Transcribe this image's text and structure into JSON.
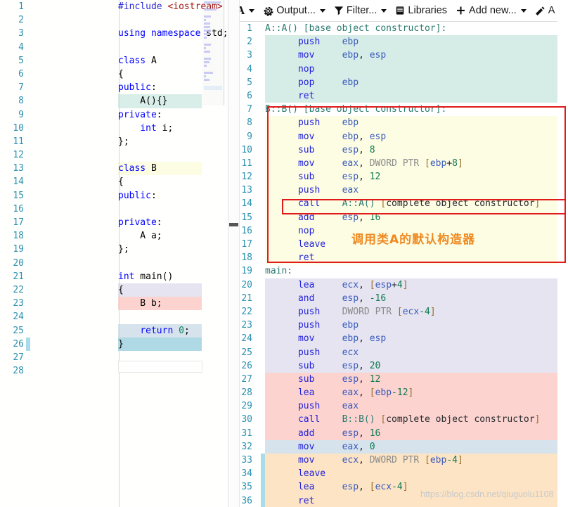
{
  "app": {
    "name": "Compiler Explorer",
    "watermark": "https://blog.csdn.net/qiuguolu1108"
  },
  "toolbar": {
    "items": [
      {
        "icon": "font-size-icon",
        "label": "A",
        "caret": true,
        "name": "font-size-button"
      },
      {
        "icon": "gear-icon",
        "label": "Output...",
        "caret": true,
        "name": "output-button"
      },
      {
        "icon": "filter-icon",
        "label": "Filter...",
        "caret": true,
        "name": "filter-button"
      },
      {
        "icon": "libraries-icon",
        "label": "Libraries",
        "caret": false,
        "name": "libraries-button"
      },
      {
        "icon": "plus-icon",
        "label": "Add new...",
        "caret": true,
        "name": "add-new-button"
      },
      {
        "icon": "wand-icon",
        "label": "A",
        "caret": false,
        "name": "add-tool-button"
      }
    ]
  },
  "source_editor": {
    "name": "cpp-source-editor",
    "language": "C++",
    "lines": [
      {
        "n": 1,
        "text": "#include <iostream>",
        "hl": null
      },
      {
        "n": 2,
        "text": "",
        "hl": null
      },
      {
        "n": 3,
        "text": "using namespace std;",
        "hl": null
      },
      {
        "n": 4,
        "text": "",
        "hl": null
      },
      {
        "n": 5,
        "text": "class A",
        "hl": null
      },
      {
        "n": 6,
        "text": "{",
        "hl": null
      },
      {
        "n": 7,
        "text": "public:",
        "hl": null
      },
      {
        "n": 8,
        "text": "    A(){}",
        "hl": "#d9eee9"
      },
      {
        "n": 9,
        "text": "private:",
        "hl": null
      },
      {
        "n": 10,
        "text": "    int i;",
        "hl": null
      },
      {
        "n": 11,
        "text": "};",
        "hl": null
      },
      {
        "n": 12,
        "text": "",
        "hl": null
      },
      {
        "n": 13,
        "text": "class B",
        "hl": "#fdfde3"
      },
      {
        "n": 14,
        "text": "{",
        "hl": null
      },
      {
        "n": 15,
        "text": "public:",
        "hl": null
      },
      {
        "n": 16,
        "text": "",
        "hl": null
      },
      {
        "n": 17,
        "text": "private:",
        "hl": null
      },
      {
        "n": 18,
        "text": "    A a;",
        "hl": null
      },
      {
        "n": 19,
        "text": "};",
        "hl": null
      },
      {
        "n": 20,
        "text": "",
        "hl": null
      },
      {
        "n": 21,
        "text": "int main()",
        "hl": null
      },
      {
        "n": 22,
        "text": "{",
        "hl": "#e5e4f0"
      },
      {
        "n": 23,
        "text": "    B b;",
        "hl": "#fcd3cf"
      },
      {
        "n": 24,
        "text": "",
        "hl": null
      },
      {
        "n": 25,
        "text": "    return 0;",
        "hl": "#d6e3ec"
      },
      {
        "n": 26,
        "text": "}",
        "hl": "#aed9e5"
      },
      {
        "n": 27,
        "text": "",
        "hl": null
      },
      {
        "n": 28,
        "text": "",
        "hl": null
      }
    ]
  },
  "asm_output": {
    "name": "assembly-output-pane",
    "lines": [
      {
        "n": 1,
        "label": "A::A() [base object constructor]:",
        "mn": "",
        "ops": "",
        "hl": null
      },
      {
        "n": 2,
        "label": "",
        "mn": "push",
        "ops": "ebp",
        "hl": "#d6ece6"
      },
      {
        "n": 3,
        "label": "",
        "mn": "mov",
        "ops": "ebp, esp",
        "hl": "#d6ece6"
      },
      {
        "n": 4,
        "label": "",
        "mn": "nop",
        "ops": "",
        "hl": "#d6ece6"
      },
      {
        "n": 5,
        "label": "",
        "mn": "pop",
        "ops": "ebp",
        "hl": "#d6ece6"
      },
      {
        "n": 6,
        "label": "",
        "mn": "ret",
        "ops": "",
        "hl": "#d6ece6"
      },
      {
        "n": 7,
        "label": "B::B() [base object constructor]:",
        "mn": "",
        "ops": "",
        "hl": null
      },
      {
        "n": 8,
        "label": "",
        "mn": "push",
        "ops": "ebp",
        "hl": "#fdfde3"
      },
      {
        "n": 9,
        "label": "",
        "mn": "mov",
        "ops": "ebp, esp",
        "hl": "#fdfde3"
      },
      {
        "n": 10,
        "label": "",
        "mn": "sub",
        "ops": "esp, 8",
        "hl": "#fdfde3"
      },
      {
        "n": 11,
        "label": "",
        "mn": "mov",
        "ops": "eax, DWORD PTR [ebp+8]",
        "hl": "#fdfde3"
      },
      {
        "n": 12,
        "label": "",
        "mn": "sub",
        "ops": "esp, 12",
        "hl": "#fdfde3"
      },
      {
        "n": 13,
        "label": "",
        "mn": "push",
        "ops": "eax",
        "hl": "#fdfde3"
      },
      {
        "n": 14,
        "label": "",
        "mn": "call",
        "ops": "A::A() [complete object constructor]",
        "hl": "#fdfde3"
      },
      {
        "n": 15,
        "label": "",
        "mn": "add",
        "ops": "esp, 16",
        "hl": "#fdfde3"
      },
      {
        "n": 16,
        "label": "",
        "mn": "nop",
        "ops": "",
        "hl": "#fdfde3"
      },
      {
        "n": 17,
        "label": "",
        "mn": "leave",
        "ops": "",
        "hl": "#fdfde3"
      },
      {
        "n": 18,
        "label": "",
        "mn": "ret",
        "ops": "",
        "hl": "#fdfde3"
      },
      {
        "n": 19,
        "label": "main:",
        "mn": "",
        "ops": "",
        "hl": null
      },
      {
        "n": 20,
        "label": "",
        "mn": "lea",
        "ops": "ecx, [esp+4]",
        "hl": "#e5e4f0"
      },
      {
        "n": 21,
        "label": "",
        "mn": "and",
        "ops": "esp, -16",
        "hl": "#e5e4f0"
      },
      {
        "n": 22,
        "label": "",
        "mn": "push",
        "ops": "DWORD PTR [ecx-4]",
        "hl": "#e5e4f0"
      },
      {
        "n": 23,
        "label": "",
        "mn": "push",
        "ops": "ebp",
        "hl": "#e5e4f0"
      },
      {
        "n": 24,
        "label": "",
        "mn": "mov",
        "ops": "ebp, esp",
        "hl": "#e5e4f0"
      },
      {
        "n": 25,
        "label": "",
        "mn": "push",
        "ops": "ecx",
        "hl": "#e5e4f0"
      },
      {
        "n": 26,
        "label": "",
        "mn": "sub",
        "ops": "esp, 20",
        "hl": "#e5e4f0"
      },
      {
        "n": 27,
        "label": "",
        "mn": "sub",
        "ops": "esp, 12",
        "hl": "#fcd3cf"
      },
      {
        "n": 28,
        "label": "",
        "mn": "lea",
        "ops": "eax, [ebp-12]",
        "hl": "#fcd3cf"
      },
      {
        "n": 29,
        "label": "",
        "mn": "push",
        "ops": "eax",
        "hl": "#fcd3cf"
      },
      {
        "n": 30,
        "label": "",
        "mn": "call",
        "ops": "B::B() [complete object constructor]",
        "hl": "#fcd3cf"
      },
      {
        "n": 31,
        "label": "",
        "mn": "add",
        "ops": "esp, 16",
        "hl": "#fcd3cf"
      },
      {
        "n": 32,
        "label": "",
        "mn": "mov",
        "ops": "eax, 0",
        "hl": "#d6e3ec"
      },
      {
        "n": 33,
        "label": "",
        "mn": "mov",
        "ops": "ecx, DWORD PTR [ebp-4]",
        "hl": "#fce4c4"
      },
      {
        "n": 34,
        "label": "",
        "mn": "leave",
        "ops": "",
        "hl": "#fce4c4"
      },
      {
        "n": 35,
        "label": "",
        "mn": "lea",
        "ops": "esp, [ecx-4]",
        "hl": "#fce4c4"
      },
      {
        "n": 36,
        "label": "",
        "mn": "ret",
        "ops": "",
        "hl": "#fce4c4"
      }
    ]
  },
  "annotations": {
    "chinese_note": "调用类A的默认构造器",
    "note_color": "#ef8a22",
    "box_color": "#e11b1b"
  }
}
